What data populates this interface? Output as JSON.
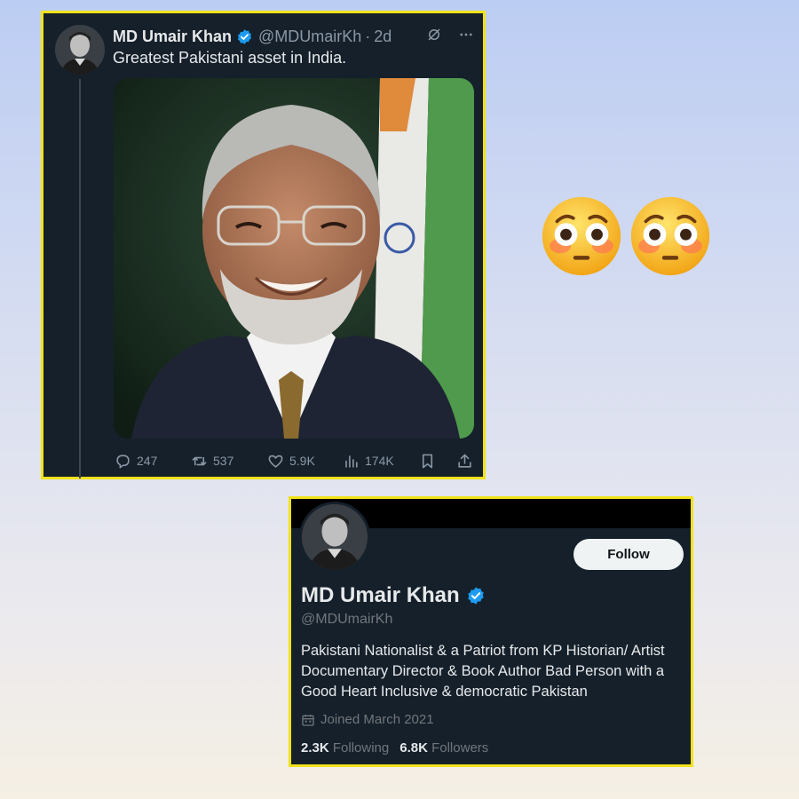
{
  "tweet": {
    "author_name": "MD Umair Khan",
    "handle": "@MDUmairKh",
    "separator": "·",
    "time": "2d",
    "text": "Greatest Pakistani asset in India.",
    "photo_alt": "Smiling man with glasses and grey beard in front of a flag",
    "actions": {
      "replies": "247",
      "retweets": "537",
      "likes": "5.9K",
      "views": "174K"
    },
    "icons": [
      "verified-badge-icon",
      "grok-icon",
      "more-icon",
      "reply-icon",
      "retweet-icon",
      "like-icon",
      "views-icon",
      "bookmark-icon",
      "share-icon"
    ]
  },
  "emojis": [
    "flushed-face",
    "flushed-face"
  ],
  "profile": {
    "name": "MD Umair Khan",
    "handle": "@MDUmairKh",
    "follow_label": "Follow",
    "bio": "Pakistani Nationalist & a Patriot from KP Historian/ Artist Documentary Director & Book Author Bad Person with a Good Heart Inclusive & democratic Pakistan",
    "joined": "Joined March 2021",
    "following_count": "2.3K",
    "following_label": "Following",
    "followers_count": "6.8K",
    "followers_label": "Followers"
  },
  "colors": {
    "card_bg": "#15202b",
    "highlight_border": "#f2e21a",
    "verified_blue": "#1d9bf0",
    "muted_text": "#8b98a5"
  }
}
